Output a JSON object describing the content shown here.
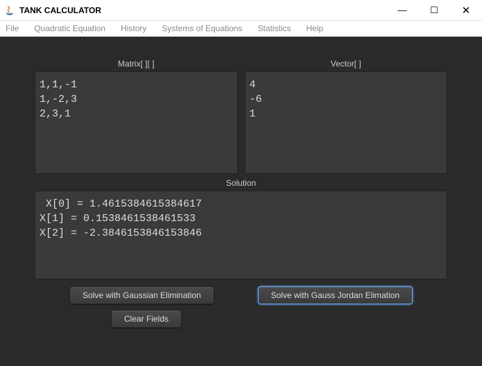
{
  "window": {
    "title": "TANK CALCULATOR"
  },
  "menu": {
    "file": "File",
    "quadratic": "Quadratic Equation",
    "history": "History",
    "systems": "Systems of Equations",
    "statistics": "Statistics",
    "help": "Help"
  },
  "labels": {
    "matrix": "Matrix[ ][ ]",
    "vector": "Vector[ ]",
    "solution": "Solution"
  },
  "inputs": {
    "matrix": "1,1,-1\n1,-2,3\n2,3,1",
    "vector": "4\n-6\n1",
    "solution": " X[0] = 1.4615384615384617\nX[1] = 0.1538461538461533\nX[2] = -2.3846153846153846"
  },
  "buttons": {
    "gaussian": "Solve with Gaussian Elimination",
    "gaussjordan": "Solve with Gauss Jordan Elimation",
    "clear": "Clear Fields"
  },
  "winctrl": {
    "min": "—",
    "max": "☐",
    "close": "✕"
  }
}
